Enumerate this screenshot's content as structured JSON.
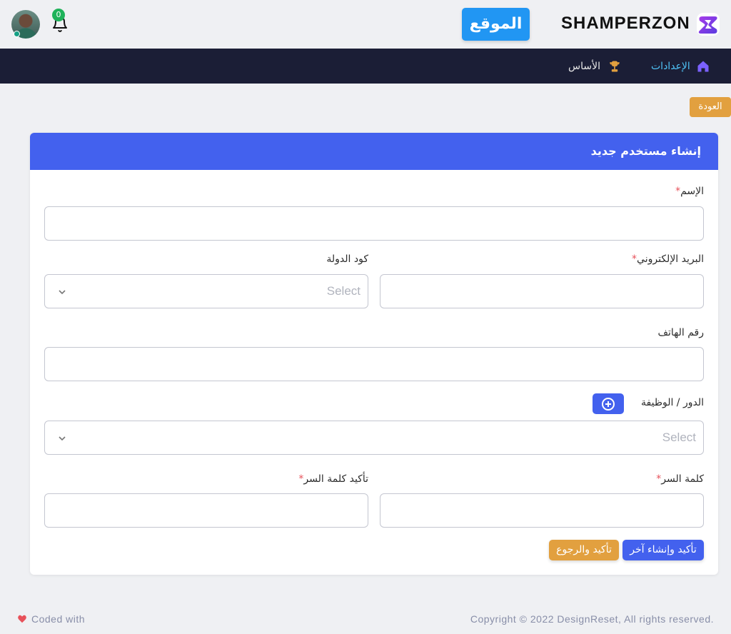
{
  "header": {
    "brand_name": "SHAMPERZON",
    "site_button": "الموقع",
    "notification_count": "0"
  },
  "nav": {
    "settings": "الإعدادات",
    "base": "الأساس"
  },
  "back_button": "العودة",
  "form": {
    "title": "إنشاء مستخدم جديد",
    "name_label": "الإسم",
    "email_label": "البريد الإلكتروني",
    "country_code_label": "كود الدولة",
    "country_code_placeholder": "Select",
    "phone_label": "رقم الهاتف",
    "role_label": "الدور / الوظيفة",
    "role_placeholder": "Select",
    "password_label": "كلمة السر",
    "confirm_password_label": "تأكيد كلمة السر",
    "required_mark": "*",
    "confirm_create_another": "تأكيد وإنشاء آخر",
    "confirm_return": "تأكيد والرجوع"
  },
  "footer": {
    "copyright": "Copyright © 2022 DesignReset, All rights reserved.",
    "coded_with": "Coded with"
  },
  "colors": {
    "primary": "#4361ee",
    "warning": "#e2a03f",
    "navbar": "#1b1e36",
    "site_button": "#2196f3",
    "required": "#e7515a"
  }
}
